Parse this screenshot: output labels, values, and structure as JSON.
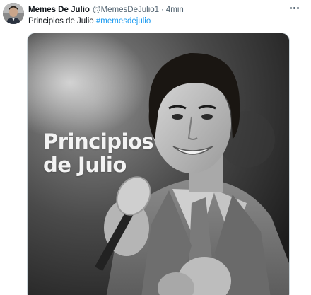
{
  "author": {
    "name": "Memes De Julio",
    "handle": "@MemesDeJulio1",
    "separator": "·",
    "time": "4min"
  },
  "tweet": {
    "text": "Principios de Julio",
    "hashtag": "#memesdejulio"
  },
  "media": {
    "caption_line1": "Principios",
    "caption_line2": "de Julio",
    "image_description_icon": "photo-grayscale"
  },
  "colors": {
    "link": "#1d9bf0",
    "text": "#0f1419",
    "muted": "#536471"
  }
}
